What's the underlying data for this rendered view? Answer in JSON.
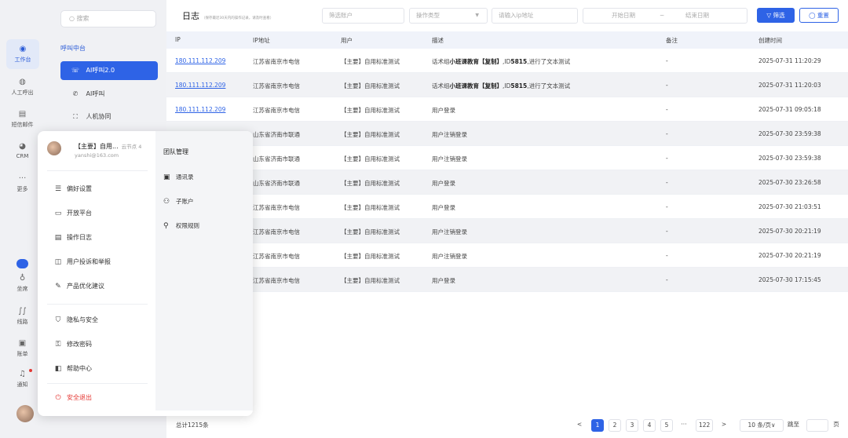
{
  "rail": {
    "items": [
      {
        "label": "工作台",
        "icon": "workbench-icon",
        "glyph": "◉"
      },
      {
        "label": "人工呼出",
        "icon": "manual-call-icon",
        "glyph": "◍"
      },
      {
        "label": "短信邮件",
        "icon": "message-icon",
        "glyph": "▤"
      },
      {
        "label": "CRM",
        "icon": "crm-icon",
        "glyph": "◕"
      },
      {
        "label": "更多",
        "icon": "more-icon",
        "glyph": "···"
      },
      {
        "label": "坐席",
        "icon": "agent-icon",
        "glyph": "♁"
      },
      {
        "label": "线路",
        "icon": "line-icon",
        "glyph": "∫∫"
      },
      {
        "label": "账单",
        "icon": "bill-icon",
        "glyph": "▣"
      },
      {
        "label": "通知",
        "icon": "bell-icon",
        "glyph": "♫"
      },
      {
        "label": "",
        "icon": "user-avatar",
        "glyph": ""
      }
    ]
  },
  "sidebar": {
    "search_placeholder": "搜索",
    "group": "呼叫中台",
    "items": [
      {
        "label": "AI呼叫2.0",
        "icon": "ai-call-icon",
        "glyph": "☏",
        "active": true
      },
      {
        "label": "AI呼叫",
        "icon": "phone-icon",
        "glyph": "✆",
        "active": false
      },
      {
        "label": "人机协同",
        "icon": "collab-icon",
        "glyph": "⛶",
        "active": false
      }
    ]
  },
  "header": {
    "title": "日志",
    "subtitle": "（保存最近30天内的操作记录，请及时查看）",
    "filter_account_placeholder": "筛选账户",
    "op_type_placeholder": "操作类型",
    "ip_placeholder": "请输入ip地址",
    "start_date": "开始日期",
    "date_sep": "~",
    "end_date": "结束日期",
    "filter_btn": "▽ 筛选",
    "reset_btn": "◯ 重置"
  },
  "table": {
    "columns": [
      "IP",
      "IP地址",
      "用户",
      "描述",
      "备注",
      "创建时间"
    ],
    "rows": [
      {
        "ip": "180.111.112.209",
        "loc": "江苏省南京市电信",
        "user": "【主要】自用标准测试",
        "desc_pre": "话术组",
        "desc_bold": "小班课教育【复制】",
        "desc_mid": ",ID",
        "desc_id": "5815",
        "desc_post": ",进行了文本测试",
        "note": "-",
        "time": "2025-07-31 11:20:29"
      },
      {
        "ip": "180.111.112.209",
        "loc": "江苏省南京市电信",
        "user": "【主要】自用标准测试",
        "desc_pre": "话术组",
        "desc_bold": "小班课教育【复制】",
        "desc_mid": ",ID",
        "desc_id": "5815",
        "desc_post": ",进行了文本测试",
        "note": "-",
        "time": "2025-07-31 11:20:03"
      },
      {
        "ip": "180.111.112.209",
        "loc": "江苏省南京市电信",
        "user": "【主要】自用标准测试",
        "desc_pre": "用户登录",
        "desc_bold": "",
        "desc_mid": "",
        "desc_id": "",
        "desc_post": "",
        "note": "-",
        "time": "2025-07-31 09:05:18"
      },
      {
        "ip": "",
        "loc": "山东省济南市联通",
        "user": "【主要】自用标准测试",
        "desc_pre": "用户注销登录",
        "desc_bold": "",
        "desc_mid": "",
        "desc_id": "",
        "desc_post": "",
        "note": "-",
        "time": "2025-07-30 23:59:38"
      },
      {
        "ip": "",
        "loc": "山东省济南市联通",
        "user": "【主要】自用标准测试",
        "desc_pre": "用户注销登录",
        "desc_bold": "",
        "desc_mid": "",
        "desc_id": "",
        "desc_post": "",
        "note": "-",
        "time": "2025-07-30 23:59:38"
      },
      {
        "ip": "",
        "loc": "山东省济南市联通",
        "user": "【主要】自用标准测试",
        "desc_pre": "用户登录",
        "desc_bold": "",
        "desc_mid": "",
        "desc_id": "",
        "desc_post": "",
        "note": "-",
        "time": "2025-07-30 23:26:58"
      },
      {
        "ip": "",
        "loc": "江苏省南京市电信",
        "user": "【主要】自用标准测试",
        "desc_pre": "用户登录",
        "desc_bold": "",
        "desc_mid": "",
        "desc_id": "",
        "desc_post": "",
        "note": "-",
        "time": "2025-07-30 21:03:51"
      },
      {
        "ip": "",
        "loc": "江苏省南京市电信",
        "user": "【主要】自用标准测试",
        "desc_pre": "用户注销登录",
        "desc_bold": "",
        "desc_mid": "",
        "desc_id": "",
        "desc_post": "",
        "note": "-",
        "time": "2025-07-30 20:21:19"
      },
      {
        "ip": "",
        "loc": "江苏省南京市电信",
        "user": "【主要】自用标准测试",
        "desc_pre": "用户注销登录",
        "desc_bold": "",
        "desc_mid": "",
        "desc_id": "",
        "desc_post": "",
        "note": "-",
        "time": "2025-07-30 20:21:19"
      },
      {
        "ip": "",
        "loc": "江苏省南京市电信",
        "user": "【主要】自用标准测试",
        "desc_pre": "用户登录",
        "desc_bold": "",
        "desc_mid": "",
        "desc_id": "",
        "desc_post": "",
        "note": "-",
        "time": "2025-07-30 17:15:45"
      }
    ]
  },
  "footer": {
    "total": "总计1215条",
    "prev": "<",
    "pages": [
      "1",
      "2",
      "3",
      "4",
      "5"
    ],
    "ellipsis": "···",
    "last": "122",
    "next": ">",
    "per_page": "10 条/页∨",
    "jump": "跳至",
    "page_unit": "页"
  },
  "popup": {
    "name": "【主要】自用...",
    "node": "云节点 4",
    "email": "yanshi@163.com",
    "menu": [
      {
        "label": "偏好设置",
        "icon": "sliders-icon",
        "glyph": "☰"
      },
      {
        "label": "开放平台",
        "icon": "platform-icon",
        "glyph": "▭"
      },
      {
        "label": "操作日志",
        "icon": "log-icon",
        "glyph": "▤"
      },
      {
        "label": "用户投诉和举报",
        "icon": "report-icon",
        "glyph": "◫"
      },
      {
        "label": "产品优化建议",
        "icon": "suggest-icon",
        "glyph": "✎"
      },
      {
        "label": "隐私与安全",
        "icon": "shield-icon",
        "glyph": "⛉"
      },
      {
        "label": "修改密码",
        "icon": "lock-icon",
        "glyph": "⚿"
      },
      {
        "label": "帮助中心",
        "icon": "book-icon",
        "glyph": "◧"
      }
    ],
    "logout": "安全退出",
    "logout_glyph": "⏻",
    "team_header": "团队管理",
    "team_items": [
      {
        "label": "通讯录",
        "icon": "contacts-icon",
        "glyph": "▣"
      },
      {
        "label": "子账户",
        "icon": "subaccount-icon",
        "glyph": "⚇"
      },
      {
        "label": "权限规则",
        "icon": "permission-icon",
        "glyph": "⚲"
      }
    ]
  },
  "colors": {
    "accent": "#2e63e6",
    "danger": "#e53935"
  }
}
